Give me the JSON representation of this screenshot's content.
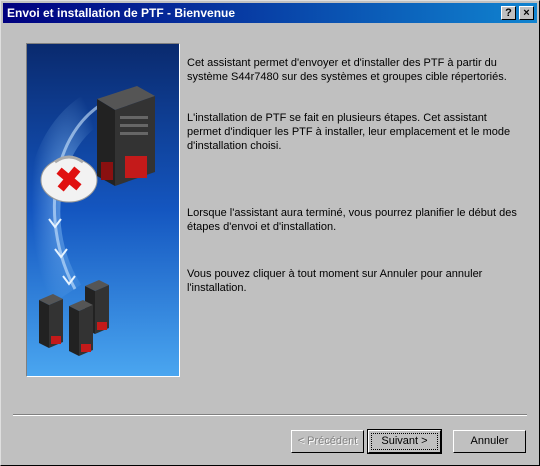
{
  "window": {
    "title": "Envoi et installation de PTF - Bienvenue",
    "help_label": "?",
    "close_label": "×"
  },
  "content": {
    "paragraphs": [
      "Cet assistant permet d'envoyer et d'installer des PTF à partir du système S44r7480 sur des systèmes et groupes cible répertoriés.",
      "L'installation de PTF se fait en plusieurs étapes. Cet assistant permet d'indiquer les PTF à installer, leur emplacement et le mode d'installation choisi.",
      "Lorsque l'assistant aura terminé, vous pourrez planifier le début des étapes d'envoi et d'installation.",
      "Vous pouvez cliquer à tout moment sur Annuler pour annuler l'installation."
    ]
  },
  "buttons": {
    "previous": "< Précédent",
    "next": "Suivant >",
    "cancel": "Annuler"
  },
  "illustration": {
    "icons": [
      "server-icon",
      "medical-kit-icon",
      "server-group-icon"
    ]
  }
}
